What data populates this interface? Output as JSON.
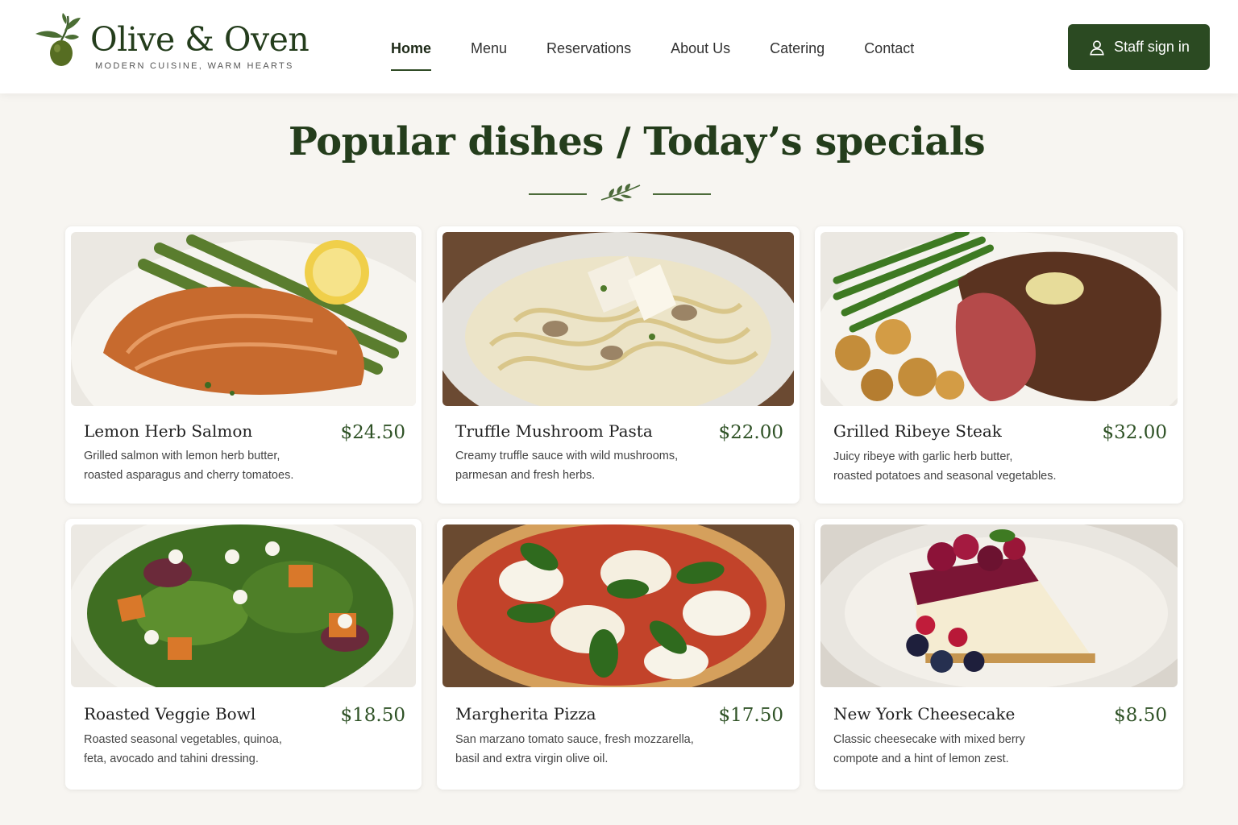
{
  "brand": {
    "name": "Olive & Oven",
    "tagline": "MODERN CUISINE, WARM HEARTS"
  },
  "nav": {
    "items": [
      {
        "label": "Home",
        "active": true
      },
      {
        "label": "Menu"
      },
      {
        "label": "Reservations"
      },
      {
        "label": "About Us"
      },
      {
        "label": "Catering"
      },
      {
        "label": "Contact"
      }
    ]
  },
  "auth": {
    "signin_label": "Staff sign in",
    "icon": "user-icon"
  },
  "section": {
    "title": "Popular dishes / Today’s specials",
    "divider_icon": "olive-sprig-icon"
  },
  "dishes": [
    {
      "name": "Lemon Herb Salmon",
      "price": "$24.50",
      "desc_line1": "Grilled salmon with lemon herb butter,",
      "desc_line2": "roasted asparagus and cherry tomatoes."
    },
    {
      "name": "Truffle Mushroom Pasta",
      "price": "$22.00",
      "desc_line1": "Creamy truffle sauce with wild mushrooms,",
      "desc_line2": "parmesan and fresh herbs."
    },
    {
      "name": "Grilled Ribeye Steak",
      "price": "$32.00",
      "desc_line1": "Juicy ribeye with garlic herb butter,",
      "desc_line2": "roasted potatoes and seasonal vegetables."
    },
    {
      "name": "Roasted Veggie Bowl",
      "price": "$18.50",
      "desc_line1": "Roasted seasonal vegetables, quinoa,",
      "desc_line2": "feta, avocado and tahini dressing."
    },
    {
      "name": "Margherita Pizza",
      "price": "$17.50",
      "desc_line1": "San marzano tomato sauce, fresh mozzarella,",
      "desc_line2": "basil and extra virgin olive oil."
    },
    {
      "name": "New York Cheesecake",
      "price": "$8.50",
      "desc_line1": "Classic cheesecake with mixed berry",
      "desc_line2": "compote and a hint of lemon zest."
    }
  ],
  "colors": {
    "brand_green": "#243d1c",
    "button_green": "#2b4a22",
    "price_green": "#2f5226",
    "background": "#f7f5f1"
  }
}
